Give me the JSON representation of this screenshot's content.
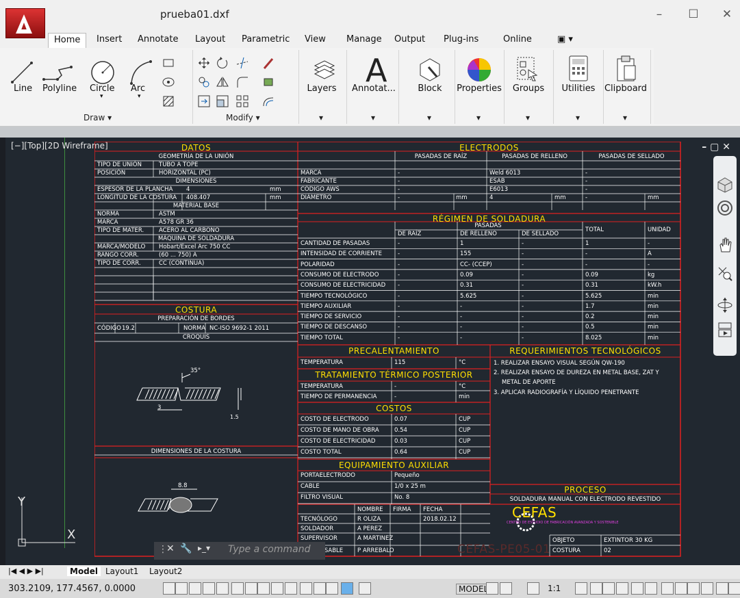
{
  "window": {
    "title": "prueba01.dxf"
  },
  "tabs": [
    "Home",
    "Insert",
    "Annotate",
    "Layout",
    "Parametric",
    "View",
    "Manage",
    "Output",
    "Plug-ins",
    "Online"
  ],
  "ribbon": {
    "draw_tools": [
      "Line",
      "Polyline",
      "Circle",
      "Arc"
    ],
    "draw_title": "Draw ▾",
    "modify_title": "Modify ▾",
    "big_tools": [
      "Layers",
      "Annotat...",
      "Block",
      "Properties",
      "Groups",
      "Utilities",
      "Clipboard"
    ]
  },
  "viewport": {
    "label": "[−][Top][2D Wireframe]",
    "controls": "–  ▢  ✕"
  },
  "drawing": {
    "h_datos": "DATOS",
    "h_costura": "COSTURA",
    "h_electrodos": "ELECTRODOS",
    "h_regimen": "RÉGIMEN DE SOLDADURA",
    "h_precal": "PRECALENTAMIENTO",
    "h_tratam": "TRATAMIENTO TÉRMICO POSTERIOR",
    "h_costos": "COSTOS",
    "h_equip": "EQUIPAMIENTO AUXILIAR",
    "h_req": "REQUERIMIENTOS TECNOLÓGICOS",
    "h_proceso": "PROCESO",
    "geo": "GEOMETRÍA DE LA UNIÓN",
    "tipo_union_l": "TIPO DE UNIÓN",
    "tipo_union": "TUBO A TOPE",
    "pos_l": "POSICIÓN",
    "pos": "HORIZONTAL (PC)",
    "dim": "DIMENSIONES",
    "esp_l": "ESPESOR DE LA PLANCHA",
    "esp": "4",
    "mm": "mm",
    "long_l": "LONGITUD DE LA COSTURA",
    "long": "408.407",
    "mat": "MATERIAL BASE",
    "norma_l": "NORMA",
    "norma": "ASTM",
    "marca_l": "MARCA",
    "marca": "A578 GR 36",
    "tipmat_l": "TIPO DE MATER.",
    "tipmat": "ACERO AL CARBONO",
    "maq": "MÁQUINA DE SOLDADURA",
    "mm_l": "MARCA/MODELO",
    "mm_v": "Hobart/Excel Arc 750 CC",
    "rango_l": "RANGO CORR.",
    "rango": "(60 ... 750) A",
    "tcorr_l": "TIPO DE CORR.",
    "tcorr": "CC (CONTINUA)",
    "prep": "PREPARACIÓN DE BORDES",
    "cod_l": "CÓDIGO",
    "cod": "19.2",
    "nor_l": "NORMA",
    "nor": "NC-ISO 9692-1 2011",
    "croquis": "CROQUIS",
    "dimcost": "DIMENSIONES DE LA COSTURA",
    "ang": "35°",
    "d3": "3",
    "d15": "1.5",
    "d88": "8.8",
    "pas_raiz": "PASADAS DE RAÍZ",
    "pas_rell": "PASADAS DE RELLENO",
    "pas_sell": "PASADAS DE SELLADO",
    "e_marca": "MARCA",
    "e_fab": "FABRICANTE",
    "e_aws": "CÓDIGO AWS",
    "e_diam": "DIÁMETRO",
    "weld": "Weld 6013",
    "esab": "ESAB",
    "e6013": "E6013",
    "d4": "4",
    "dash": "-",
    "pasadas": "PASADAS",
    "deraiz": "DE RAÍZ",
    "derell": "DE RELLENO",
    "desell": "DE SELLADO",
    "total": "TOTAL",
    "unidad": "UNIDAD",
    "r_rows": [
      {
        "l": "CANTIDAD DE PASADAS",
        "a": "-",
        "b": "1",
        "c": "-",
        "t": "1",
        "u": "-"
      },
      {
        "l": "INTENSIDAD DE CORRIENTE",
        "a": "-",
        "b": "155",
        "c": "-",
        "t": "-",
        "u": "A"
      },
      {
        "l": "POLARIDAD",
        "a": "-",
        "b": "CC- (CCEP)",
        "c": "-",
        "t": "-",
        "u": "-"
      },
      {
        "l": "CONSUMO DE ELECTRODO",
        "a": "-",
        "b": "0.09",
        "c": "-",
        "t": "0.09",
        "u": "kg"
      },
      {
        "l": "CONSUMO DE ELECTRICIDAD",
        "a": "-",
        "b": "0.31",
        "c": "-",
        "t": "0.31",
        "u": "kW.h"
      },
      {
        "l": "TIEMPO TECNOLÓGICO",
        "a": "-",
        "b": "5.625",
        "c": "-",
        "t": "5.625",
        "u": "min"
      },
      {
        "l": "TIEMPO AUXILIAR",
        "a": "-",
        "b": "-",
        "c": "-",
        "t": "1.7",
        "u": "min"
      },
      {
        "l": "TIEMPO DE SERVICIO",
        "a": "-",
        "b": "-",
        "c": "-",
        "t": "0.2",
        "u": "min"
      },
      {
        "l": "TIEMPO DE DESCANSO",
        "a": "-",
        "b": "-",
        "c": "-",
        "t": "0.5",
        "u": "min"
      },
      {
        "l": "TIEMPO TOTAL",
        "a": "-",
        "b": "-",
        "c": "-",
        "t": "8.025",
        "u": "min"
      }
    ],
    "temp_l": "TEMPERATURA",
    "temp": "115",
    "gc": "°C",
    "tperm_l": "TIEMPO DE PERMANENCIA",
    "min": "min",
    "costos": [
      {
        "l": "COSTO DE ELECTRODO",
        "v": "0.07",
        "u": "CUP"
      },
      {
        "l": "COSTO DE MANO DE OBRA",
        "v": "0.54",
        "u": "CUP"
      },
      {
        "l": "COSTO DE ELECTRICIDAD",
        "v": "0.03",
        "u": "CUP"
      },
      {
        "l": "COSTO TOTAL",
        "v": "0.64",
        "u": "CUP"
      }
    ],
    "porta_l": "PORTAELECTRODO",
    "porta": "Pequeño",
    "cable_l": "CABLE",
    "cable": "1/0 x 25 m",
    "filtro_l": "FILTRO VISUAL",
    "filtro": "No. 8",
    "req1": "1. REALIZAR ENSAYO VISUAL SEGÚN QW-190",
    "req2": "2. REALIZAR ENSAYO DE DUREZA EN METAL BASE, ZAT Y",
    "req3": "METAL DE APORTE",
    "req4": "3. APLICAR RADIOGRAFÍA Y LÍQUIDO PENETRANTE",
    "proceso": "SOLDADURA MANUAL CON ELECTRODO REVESTIDO",
    "nombre": "NOMBRE",
    "firma": "FIRMA",
    "fecha": "FECHA",
    "tec_l": "TECNÓLOGO",
    "tec": "R OLIZA",
    "fec": "2018.02.12",
    "sol_l": "SOLDADOR",
    "sol": "A PEREZ",
    "sup_l": "SUPERVISOR",
    "sup": "A MARTINEZ",
    "resp_l": "RESPONSABLE",
    "resp": "P ARREBALO",
    "cefas": "CEFAS",
    "cefas_sub": "CENTRO DE ESTUDIO DE FABRICACIÓN AVANZADA Y SOSTENIBLE",
    "code": "CEFAS-PE05-01",
    "objeto_l": "OBJETO",
    "objeto": "EXTINTOR 30 KG",
    "cost_l": "COSTURA",
    "cost": "02"
  },
  "command": {
    "placeholder": "Type a command"
  },
  "layouts": [
    "Model",
    "Layout1",
    "Layout2"
  ],
  "status": {
    "coords": "303.2109, 177.4567, 0.0000",
    "model": "MODEL",
    "scale": "1:1"
  }
}
